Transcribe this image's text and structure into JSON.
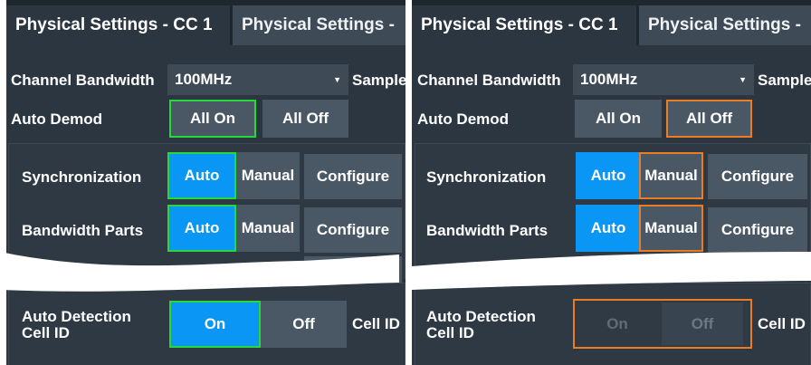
{
  "panels": [
    {
      "tabs": [
        "Physical Settings - CC 1",
        "Physical Settings -"
      ],
      "channel_bandwidth_label": "Channel Bandwidth",
      "channel_bandwidth_value": "100MHz",
      "sample_label": "Sample",
      "auto_demod_label": "Auto Demod",
      "all_on": "All On",
      "all_off": "All Off",
      "sync_label": "Synchronization",
      "bwp_label": "Bandwidth Parts",
      "auto": "Auto",
      "manual": "Manual",
      "configure": "Configure",
      "auto_detection_label_1": "Auto Detection",
      "auto_detection_label_2": "Cell ID",
      "on": "On",
      "off": "Off",
      "cell_id": "Cell ID"
    },
    {
      "tabs": [
        "Physical Settings - CC 1",
        "Physical Settings -"
      ],
      "channel_bandwidth_label": "Channel Bandwidth",
      "channel_bandwidth_value": "100MHz",
      "sample_label": "Sample",
      "auto_demod_label": "Auto Demod",
      "all_on": "All On",
      "all_off": "All Off",
      "sync_label": "Synchronization",
      "bwp_label": "Bandwidth Parts",
      "auto": "Auto",
      "manual": "Manual",
      "configure": "Configure",
      "auto_detection_label_1": "Auto Detection",
      "auto_detection_label_2": "Cell ID",
      "on": "On",
      "off": "Off",
      "cell_id": "Cell ID"
    }
  ],
  "colors": {
    "background": "#2b3640",
    "button": "#4a5866",
    "active_blue": "#0a96f5",
    "highlight_green": "#27d83a",
    "highlight_orange": "#ec7c22"
  }
}
